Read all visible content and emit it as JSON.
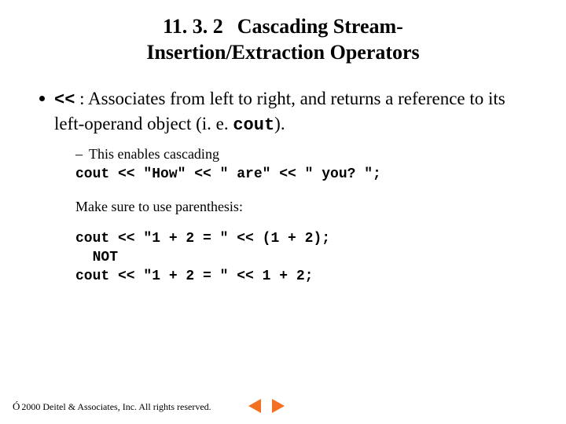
{
  "title": {
    "section_number": "11. 3. 2",
    "text_line1": "Cascading Stream-",
    "text_line2": "Insertion/Extraction Operators"
  },
  "bullet": {
    "op": "<<",
    "sep": " : ",
    "text1": " Associates from left to right, and returns a reference to its left-operand object (i. e. ",
    "cout": "cout",
    "text2": ")."
  },
  "sub": {
    "dash": "–",
    "text": "This enables cascading"
  },
  "code1": "cout << \"How\" << \" are\" << \" you? \";",
  "note": "Make sure to use parenthesis:",
  "code2": "cout << \"1 + 2 = \" << (1 + 2);\n  NOT\ncout << \"1 + 2 = \" << 1 + 2;",
  "footer": {
    "copy_symbol": "Ó",
    "text": " 2000 Deitel & Associates, Inc.  All rights reserved."
  },
  "nav": {
    "color": "#f36f21"
  }
}
